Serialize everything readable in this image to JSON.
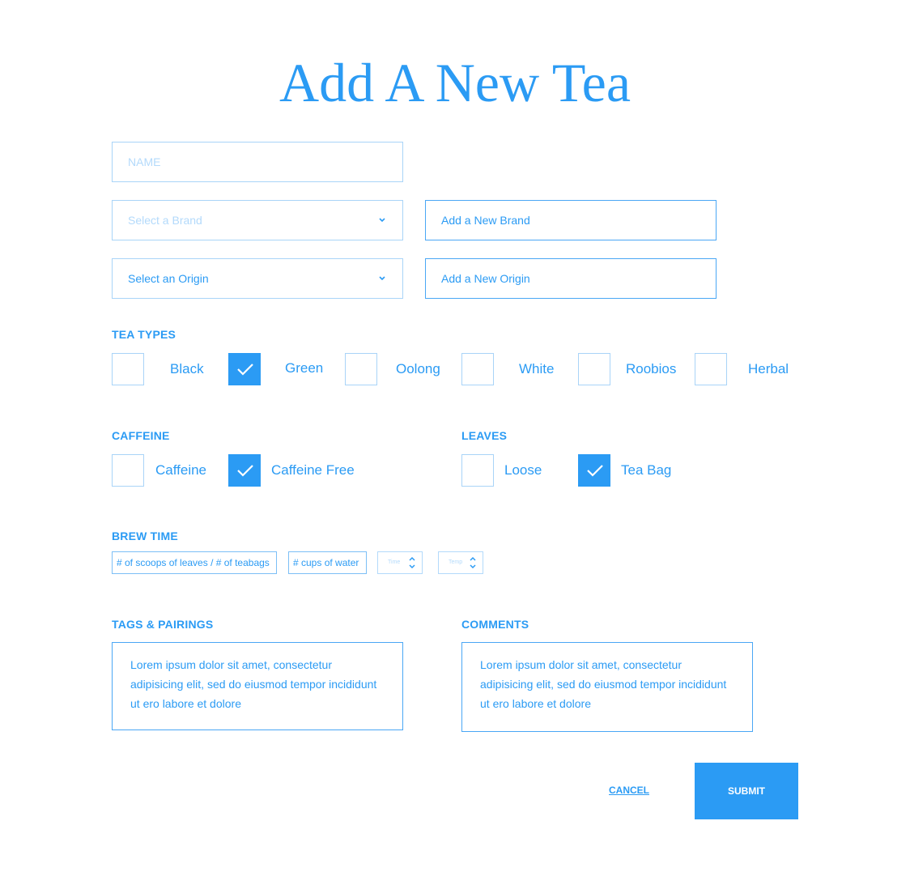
{
  "page": {
    "title": "Add A New Tea"
  },
  "form": {
    "name": {
      "placeholder": "NAME"
    },
    "brand_select": {
      "placeholder": "Select a Brand"
    },
    "brand_new": {
      "value": "Add a New Brand"
    },
    "origin_select": {
      "value": "Select an Origin"
    },
    "origin_new": {
      "value": "Add a New Origin"
    },
    "tea_types": {
      "label": "TEA TYPES",
      "options": [
        {
          "label": "Black",
          "checked": false
        },
        {
          "label": "Green",
          "checked": true
        },
        {
          "label": "Oolong",
          "checked": false
        },
        {
          "label": "White",
          "checked": false
        },
        {
          "label": "Roobios",
          "checked": false
        },
        {
          "label": "Herbal",
          "checked": false
        }
      ]
    },
    "caffeine": {
      "label": "CAFFEINE",
      "options": [
        {
          "label": "Caffeine",
          "checked": false
        },
        {
          "label": "Caffeine Free",
          "checked": true
        }
      ]
    },
    "leaves": {
      "label": "LEAVES",
      "options": [
        {
          "label": "Loose",
          "checked": false
        },
        {
          "label": "Tea Bag",
          "checked": true
        }
      ]
    },
    "brew_time": {
      "label": "BREW TIME",
      "scoops": "# of scoops of leaves / # of teabags",
      "cups": "# cups of water",
      "time_placeholder": "Time",
      "temp_placeholder": "Temp"
    },
    "tags": {
      "label": "TAGS & PAIRINGS",
      "text": "Lorem ipsum dolor sit amet, consectetur adipisicing elit, sed do eiusmod tempor incididunt ut ero labore et dolore"
    },
    "comments": {
      "label": "COMMENTS",
      "text": "Lorem ipsum dolor sit amet, consectetur adipisicing elit, sed do eiusmod tempor incididunt ut ero labore et dolore"
    }
  },
  "actions": {
    "cancel": "CANCEL",
    "submit": "SUBMIT"
  },
  "colors": {
    "accent": "#2b9bf4",
    "border_light": "#a9d4f8",
    "placeholder": "#b3dafb"
  },
  "icons": {
    "select_arrow": "chevron-down-icon",
    "checkbox_mark": "checkmark-icon",
    "spinner": "spinner-arrows-icon"
  }
}
